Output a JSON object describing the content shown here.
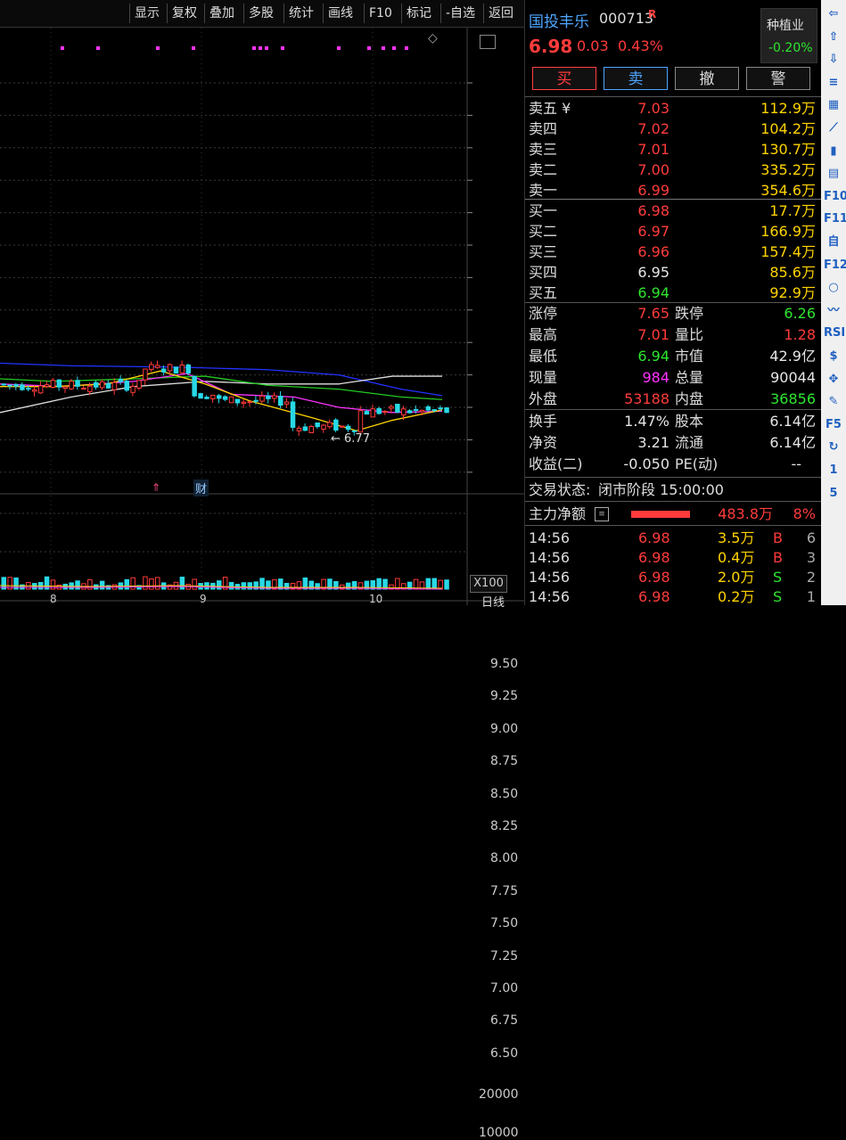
{
  "toolbar": {
    "items": [
      "显示",
      "复权",
      "叠加",
      "多股",
      "统计",
      "画线",
      "F10",
      "标记",
      "-自选",
      "返回"
    ]
  },
  "chart": {
    "price_ticks": [
      "9.50",
      "9.25",
      "9.00",
      "8.75",
      "8.50",
      "8.25",
      "8.00",
      "7.75",
      "7.50",
      "7.25",
      "7.00",
      "6.75",
      "6.50"
    ],
    "volume_ticks": [
      "20000",
      "10000"
    ],
    "volume_unit": "X100",
    "period_label": "日线",
    "date_labels": [
      "8",
      "9",
      "10"
    ],
    "low_marker": "6.77",
    "finance_marker": "财"
  },
  "stock": {
    "name": "国投丰乐",
    "code": "000713",
    "flag": "R",
    "price": "6.98",
    "change": "0.03",
    "change_pct": "0.43%",
    "sector_name": "种植业",
    "sector_change": "-0.20%"
  },
  "trade_buttons": [
    "买",
    "卖",
    "撤",
    "警"
  ],
  "order_book": {
    "asks": [
      {
        "label": "卖五 ¥",
        "price": "7.03",
        "vol": "112.9万"
      },
      {
        "label": "卖四",
        "price": "7.02",
        "vol": "104.2万"
      },
      {
        "label": "卖三",
        "price": "7.01",
        "vol": "130.7万"
      },
      {
        "label": "卖二",
        "price": "7.00",
        "vol": "335.2万"
      },
      {
        "label": "卖一",
        "price": "6.99",
        "vol": "354.6万"
      }
    ],
    "bids": [
      {
        "label": "买一",
        "price": "6.98",
        "vol": "17.7万"
      },
      {
        "label": "买二",
        "price": "6.97",
        "vol": "166.9万"
      },
      {
        "label": "买三",
        "price": "6.96",
        "vol": "157.4万"
      },
      {
        "label": "买四",
        "price": "6.95",
        "vol": "85.6万"
      },
      {
        "label": "买五",
        "price": "6.94",
        "vol": "92.9万"
      }
    ]
  },
  "stats": {
    "limit_up_label": "涨停",
    "limit_up": "7.65",
    "limit_down_label": "跌停",
    "limit_down": "6.26",
    "high_label": "最高",
    "high": "7.01",
    "vol_ratio_label": "量比",
    "vol_ratio": "1.28",
    "low_label": "最低",
    "low": "6.94",
    "mkt_cap_label": "市值",
    "mkt_cap": "42.9亿",
    "cur_vol_label": "现量",
    "cur_vol": "984",
    "total_vol_label": "总量",
    "total_vol": "90044",
    "outer_label": "外盘",
    "outer": "53188",
    "inner_label": "内盘",
    "inner": "36856",
    "turnover_label": "换手",
    "turnover": "1.47%",
    "shares_label": "股本",
    "shares": "6.14亿",
    "nav_label": "净资",
    "nav": "3.21",
    "float_label": "流通",
    "float": "6.14亿",
    "eps_label": "收益(二)",
    "eps": "-0.050",
    "pe_label": "PE(动)",
    "pe": "--"
  },
  "status": {
    "label": "交易状态:",
    "value": "闭市阶段 15:00:00"
  },
  "main_force": {
    "label": "主力净额",
    "value": "483.8万",
    "pct": "8%",
    "ratio": 0.55
  },
  "ticks": [
    {
      "time": "14:56",
      "price": "6.98",
      "vol": "3.5万",
      "side": "B",
      "count": "6"
    },
    {
      "time": "14:56",
      "price": "6.98",
      "vol": "0.4万",
      "side": "B",
      "count": "3"
    },
    {
      "time": "14:56",
      "price": "6.98",
      "vol": "2.0万",
      "side": "S",
      "count": "2"
    },
    {
      "time": "14:56",
      "price": "6.98",
      "vol": "0.2万",
      "side": "S",
      "count": "1"
    }
  ],
  "sidebar_icons": [
    "arrow-left-icon",
    "arrow-up-icon",
    "arrow-down-icon",
    "list-icon",
    "grid-icon",
    "line-chart-icon",
    "candle-icon",
    "report-icon",
    "f10-icon",
    "f11-icon",
    "self-icon",
    "f12-icon",
    "circle-icon",
    "wave-icon",
    "rsi-icon",
    "money-icon",
    "move-icon",
    "pencil-icon",
    "f5-icon",
    "refresh-icon",
    "page-1-icon",
    "page-5-icon"
  ],
  "sidebar_labels": [
    "⇦",
    "⇧",
    "⇩",
    "≡",
    "▦",
    "⟋",
    "▮",
    "▤",
    "F10",
    "F11",
    "自",
    "F12",
    "○",
    "〰",
    "RSI",
    "$",
    "✥",
    "✎",
    "F5",
    "↻",
    "1",
    "5"
  ]
}
